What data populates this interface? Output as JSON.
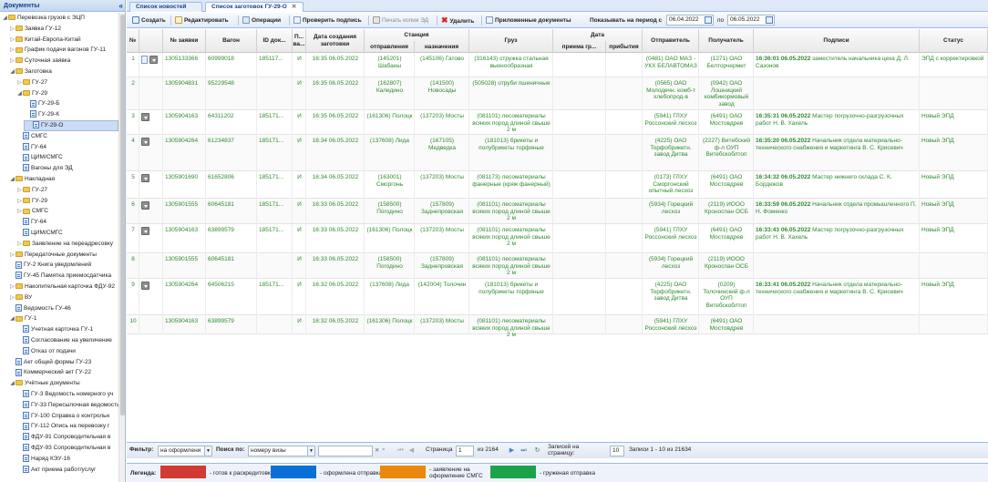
{
  "left_panel": {
    "title": "Документы",
    "tree": [
      {
        "label": "Перевозка грузов с ЭЦП",
        "level": 0,
        "type": "folder",
        "open": true
      },
      {
        "label": "Заявка ГУ-12",
        "level": 1,
        "type": "folder",
        "open": false
      },
      {
        "label": "Китай-Европа-Китай",
        "level": 1,
        "type": "folder",
        "open": false
      },
      {
        "label": "График подачи вагонов ГУ-11",
        "level": 1,
        "type": "folder",
        "open": false
      },
      {
        "label": "Суточная заявка",
        "level": 1,
        "type": "folder",
        "open": false
      },
      {
        "label": "Заготовка",
        "level": 1,
        "type": "folder",
        "open": true
      },
      {
        "label": "ГУ-27",
        "level": 2,
        "type": "folder",
        "open": false
      },
      {
        "label": "ГУ-29",
        "level": 2,
        "type": "folder",
        "open": true
      },
      {
        "label": "ГУ-29-Б",
        "level": 3,
        "type": "doc"
      },
      {
        "label": "ГУ-29-К",
        "level": 3,
        "type": "doc"
      },
      {
        "label": "ГУ-29-О",
        "level": 3,
        "type": "doc",
        "selected": true
      },
      {
        "label": "СМГС",
        "level": 2,
        "type": "doc"
      },
      {
        "label": "ГУ-64",
        "level": 2,
        "type": "doc"
      },
      {
        "label": "ЦИМ/СМГС",
        "level": 2,
        "type": "doc"
      },
      {
        "label": "Вагоны для ЭД",
        "level": 2,
        "type": "doc"
      },
      {
        "label": "Накладная",
        "level": 1,
        "type": "folder",
        "open": true
      },
      {
        "label": "ГУ-27",
        "level": 2,
        "type": "folder",
        "open": false
      },
      {
        "label": "ГУ-29",
        "level": 2,
        "type": "folder",
        "open": false
      },
      {
        "label": "СМГС",
        "level": 2,
        "type": "folder",
        "open": false
      },
      {
        "label": "ГУ-64",
        "level": 2,
        "type": "doc"
      },
      {
        "label": "ЦИМ/СМГС",
        "level": 2,
        "type": "doc"
      },
      {
        "label": "Заявление на переадресовку",
        "level": 2,
        "type": "folder",
        "open": false
      },
      {
        "label": "Передаточные документы",
        "level": 1,
        "type": "folder",
        "open": false
      },
      {
        "label": "ГУ-2 Книга уведомлений",
        "level": 1,
        "type": "doc"
      },
      {
        "label": "ГУ-45 Памятка приемосдатчика",
        "level": 1,
        "type": "doc"
      },
      {
        "label": "Накопительная карточка ФДУ-92",
        "level": 1,
        "type": "folder",
        "open": false
      },
      {
        "label": "ВУ",
        "level": 1,
        "type": "folder",
        "open": false
      },
      {
        "label": "Ведомость ГУ-46",
        "level": 1,
        "type": "doc"
      },
      {
        "label": "ГУ-1",
        "level": 1,
        "type": "folder",
        "open": true
      },
      {
        "label": "Учетная карточка ГУ-1",
        "level": 2,
        "type": "doc"
      },
      {
        "label": "Согласование на увеличение",
        "level": 2,
        "type": "doc"
      },
      {
        "label": "Отказ от подачи",
        "level": 2,
        "type": "doc"
      },
      {
        "label": "Акт общей формы ГУ-23",
        "level": 1,
        "type": "doc"
      },
      {
        "label": "Коммерческий акт ГУ-22",
        "level": 1,
        "type": "doc"
      },
      {
        "label": "Учётные документы",
        "level": 1,
        "type": "folder",
        "open": true
      },
      {
        "label": "ГУ-3 Ведомость номерного уч",
        "level": 2,
        "type": "doc"
      },
      {
        "label": "ГУ-33 Пересылочная ведомость",
        "level": 2,
        "type": "doc"
      },
      {
        "label": "ГУ-100 Справка о контрольн",
        "level": 2,
        "type": "doc"
      },
      {
        "label": "ГУ-112 Опись на перевозку г",
        "level": 2,
        "type": "doc"
      },
      {
        "label": "ФДУ-91 Сопроводительная в",
        "level": 2,
        "type": "doc"
      },
      {
        "label": "ФДУ-93 Сопроводительная в",
        "level": 2,
        "type": "doc"
      },
      {
        "label": "Наряд КЭУ-16",
        "level": 2,
        "type": "doc"
      },
      {
        "label": "Акт приема работ/услуг",
        "level": 2,
        "type": "doc"
      }
    ]
  },
  "tabs": [
    {
      "label": "Список новостей",
      "active": false
    },
    {
      "label": "Список заготовок ГУ-29-О",
      "active": true
    }
  ],
  "toolbar": {
    "create": "Создать",
    "edit": "Редактировать",
    "operations": "Операции",
    "check_sign": "Проверить подпись",
    "print_copy": "Печать копии ЭД",
    "delete": "Удалить",
    "attached": "Приложенные документы",
    "period_label": "Показывать на период с",
    "date_from": "06.04.2022",
    "to_label": "по",
    "date_to": "06.05.2022"
  },
  "grid": {
    "headers": {
      "num": "№",
      "request": "№ заявки",
      "wagon": "Вагон",
      "doc_id": "ID док...",
      "p": "П... ва...",
      "created": "Дата создания заготовки",
      "station": "Станция",
      "dep": "отправления",
      "dest": "назначения",
      "cargo": "Груз",
      "date": "Дата",
      "accept": "приема гр...",
      "arrival": "прибытия",
      "sender": "Отправитель",
      "receiver": "Получатель",
      "signatures": "Подписи",
      "status": "Статус"
    },
    "rows": [
      {
        "num": "1",
        "icons": [
          "page",
          "dl"
        ],
        "request": "1305133366",
        "wagon": "60999018",
        "doc_id": "185117...",
        "p": "И",
        "created": "16:35 06.05.2022",
        "dep": "(145201) Шабаны",
        "dest": "(145106) Гатово",
        "cargo": "(316143) стружка стальная вьюнообразная",
        "sender": "(0481) ОАО МАЗ - УКХ БЕЛАВТОМАЗ",
        "receiver": "(1271) ОАО Белторчермет",
        "sig_time": "16:36:01 06.05.2022",
        "sig_text": "заместитель начальника цеха Д. Л. Сазонов",
        "status": "ЭПД с корректировкой"
      },
      {
        "num": "2",
        "icons": [],
        "request": "1305904831",
        "wagon": "95229548",
        "doc_id": "",
        "p": "И",
        "created": "16:35 06.05.2022",
        "dep": "(162807) Каледино",
        "dest": "(141500) Новосады",
        "cargo": "(505028) отруби пшеничные",
        "sender": "(0565) ОАО Молодечн. комб-т хлебопрод-в",
        "receiver": "(0942) ОАО Лошницкий комбикормовый завод",
        "sig_time": "",
        "sig_text": "",
        "status": ""
      },
      {
        "num": "3",
        "icons": [
          "dl"
        ],
        "request": "1305904163",
        "wagon": "64311202",
        "doc_id": "185171...",
        "p": "И",
        "created": "16:35 06.05.2022",
        "dep": "(161306) Полоцк",
        "dest": "(137203) Мосты",
        "cargo": "(081101) лесоматериалы всяких пород длиной свыше 2 м",
        "sender": "(5941) ГЛХУ Россонский лесхоз",
        "receiver": "(6491) ОАО Мостовдрев",
        "sig_time": "16:35:31 06.05.2022",
        "sig_text": "Мастер погрузочно-разгрузочных работ Н. В. Хахель",
        "status": "Новый ЭПД"
      },
      {
        "num": "4",
        "icons": [
          "dl"
        ],
        "request": "1305904264",
        "wagon": "61234837",
        "doc_id": "185171...",
        "p": "И",
        "created": "16:34 06.05.2022",
        "dep": "(137608) Лида",
        "dest": "(167105) Медведка",
        "cargo": "(181013) брикеты и полубрикеты торфяные",
        "sender": "(4225) ОАО Торфобрикетн. завод Дитва",
        "receiver": "(2227) Витебский ф-л ОУП Витебскоблтоп",
        "sig_time": "16:35:20 06.05.2022",
        "sig_text": "Начальник отдела материально-технического снабжения и маркетинга В. С. Крисевич",
        "status": "Новый ЭПД"
      },
      {
        "num": "5",
        "icons": [
          "dl"
        ],
        "request": "1305901690",
        "wagon": "61652806",
        "doc_id": "185171...",
        "p": "И",
        "created": "16:34 06.05.2022",
        "dep": "(163001) Сморгонь",
        "dest": "(137203) Мосты",
        "cargo": "(081173) лесоматериалы фанерные (кряж фанерный)",
        "sender": "(0173) ГЛХУ Сморгонский опытный лесхоз",
        "receiver": "(6491) ОАО Мостовдрев",
        "sig_time": "16:34:32 06.05.2022",
        "sig_text": "Мастер нижнего склада С. К. Бордюков",
        "status": "Новый ЭПД"
      },
      {
        "num": "6",
        "icons": [
          "dl"
        ],
        "request": "1305901555",
        "wagon": "60645181",
        "doc_id": "185171...",
        "p": "И",
        "created": "16:33 06.05.2022",
        "dep": "(158500) Погодино",
        "dest": "(157809) Заднепровская",
        "cargo": "(081101) лесоматериалы всяких пород длиной свыше 2 м",
        "sender": "(5934) Горецкий лесхоз",
        "receiver": "(2119) ИООО Кроноспан ОСБ",
        "sig_time": "16:33:59 06.05.2022",
        "sig_text": "Начальник отдела промышленного П. Н. Фоменко",
        "status": "Новый ЭПД"
      },
      {
        "num": "7",
        "icons": [
          "dl"
        ],
        "request": "1305904163",
        "wagon": "63899579",
        "doc_id": "185171...",
        "p": "И",
        "created": "16:33 06.05.2022",
        "dep": "(161306) Полоцк",
        "dest": "(137203) Мосты",
        "cargo": "(081101) лесоматериалы всяких пород длиной свыше 2 м",
        "sender": "(5941) ГЛХУ Россонский лесхоз",
        "receiver": "(6491) ОАО Мостовдрев",
        "sig_time": "16:33:43 06.05.2022",
        "sig_text": "Мастер погрузочно-разгрузочных работ Н. В. Хахель",
        "status": "Новый ЭПД"
      },
      {
        "num": "8",
        "icons": [],
        "request": "1305901555",
        "wagon": "60645181",
        "doc_id": "",
        "p": "И",
        "created": "16:33 06.05.2022",
        "dep": "(158500) Погодино",
        "dest": "(157809) Заднепровская",
        "cargo": "(081101) лесоматериалы всяких пород длиной свыше 2 м",
        "sender": "(5934) Горецкий лесхоз",
        "receiver": "(2119) ИООО Кроноспан ОСБ",
        "sig_time": "",
        "sig_text": "",
        "status": ""
      },
      {
        "num": "9",
        "icons": [
          "dl"
        ],
        "request": "1305904264",
        "wagon": "64506215",
        "doc_id": "185171...",
        "p": "И",
        "created": "16:32 06.05.2022",
        "dep": "(137608) Лида",
        "dest": "(142004) Толочин",
        "cargo": "(181013) брикеты и полубрикеты торфяные",
        "sender": "(4225) ОАО Торфобрикетн. завод Дитва",
        "receiver": "(0209) Толочинский ф-л ОУП Витебскоблтоп",
        "sig_time": "16:33:41 06.05.2022",
        "sig_text": "Начальник отдела материально-технического снабжения и маркетинга В. С. Крисевич",
        "status": "Новый ЭПД"
      },
      {
        "num": "10",
        "icons": [],
        "request": "1305904163",
        "wagon": "63899579",
        "doc_id": "",
        "p": "И",
        "created": "16:32 06.05.2022",
        "dep": "(161306) Полоцк",
        "dest": "(137203) Мосты",
        "cargo": "(081101) лесоматериалы всяких пород длиной свыше 2 м",
        "sender": "(5941) ГЛХУ Россонский лесхоз",
        "receiver": "(6491) ОАО Мостовдрев",
        "sig_time": "",
        "sig_text": "",
        "status": ""
      }
    ]
  },
  "bottom": {
    "filter_label": "Фильтр:",
    "filter_value": "на оформлени",
    "search_label": "Поиск по:",
    "search_field": "номеру визы",
    "search_value": "",
    "page_label": "Страница",
    "page": "1",
    "of_pages": "из 2164",
    "per_page_label": "Записей на страницу:",
    "per_page": "10",
    "records": "Записи 1 - 10 из 21634"
  },
  "legend": {
    "label": "Легенда:",
    "items": [
      {
        "color": "#d23b33",
        "text": "- готов к раскредитовке"
      },
      {
        "color": "#0a6fd8",
        "text": "- оформлена отправка"
      },
      {
        "color": "#e8890d",
        "text": "- заявление на оформление СМГС"
      },
      {
        "color": "#1ca34a",
        "text": "- груженая отправка"
      }
    ]
  }
}
